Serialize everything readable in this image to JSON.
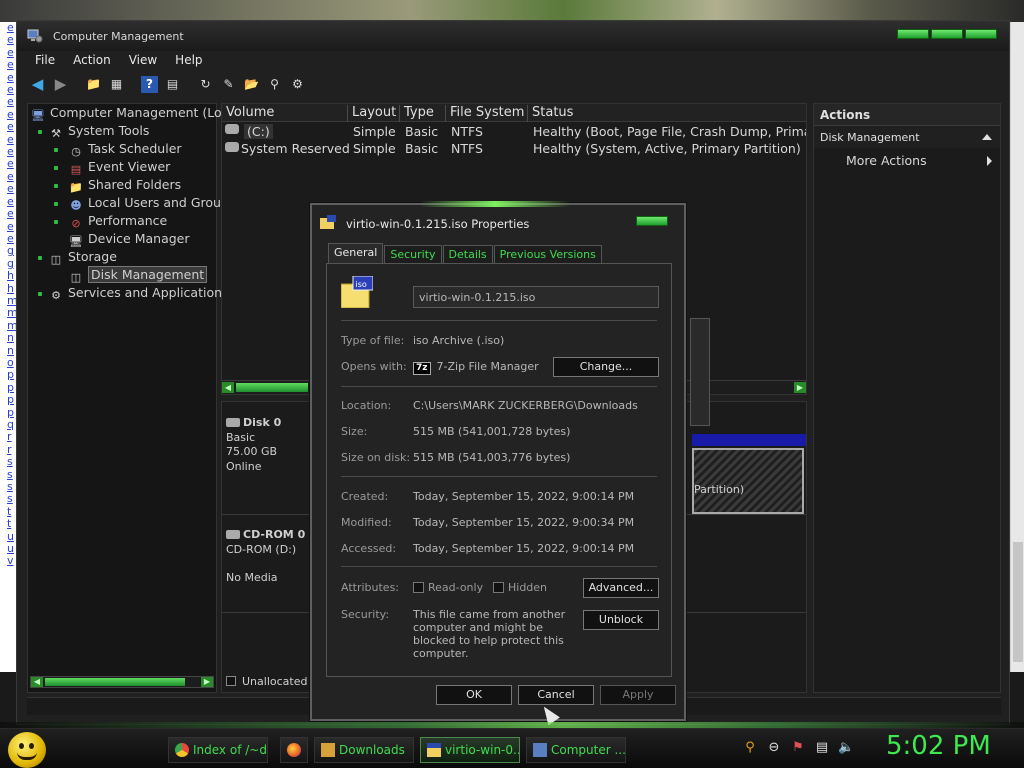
{
  "window": {
    "title": "Computer Management",
    "menu": [
      "File",
      "Action",
      "View",
      "Help"
    ]
  },
  "tree": {
    "root": "Computer Management (Loc",
    "system_tools": "System Tools",
    "task_scheduler": "Task Scheduler",
    "event_viewer": "Event Viewer",
    "shared_folders": "Shared Folders",
    "local_users": "Local Users and Grou",
    "performance": "Performance",
    "device_manager": "Device Manager",
    "storage": "Storage",
    "disk_management": "Disk Management",
    "services": "Services and Application:"
  },
  "volumes": {
    "columns": [
      "Volume",
      "Layout",
      "Type",
      "File System",
      "Status"
    ],
    "rows": [
      {
        "volume": "(C:)",
        "layout": "Simple",
        "type": "Basic",
        "fs": "NTFS",
        "status": "Healthy (Boot, Page File, Crash Dump, Primary"
      },
      {
        "volume": "System Reserved",
        "layout": "Simple",
        "type": "Basic",
        "fs": "NTFS",
        "status": "Healthy (System, Active, Primary Partition)"
      }
    ]
  },
  "disks": {
    "disk0": {
      "name": "Disk 0",
      "type": "Basic",
      "size": "75.00 GB",
      "state": "Online",
      "partition_text": "Partition)"
    },
    "cdrom0": {
      "name": "CD-ROM 0",
      "type": "CD-ROM (D:)",
      "state": "No Media"
    },
    "legend_unallocated": "Unallocated"
  },
  "actions": {
    "header": "Actions",
    "section": "Disk Management",
    "more": "More Actions"
  },
  "dialog": {
    "title": "virtio-win-0.1.215.iso Properties",
    "tabs": [
      "General",
      "Security",
      "Details",
      "Previous Versions"
    ],
    "file_name": "virtio-win-0.1.215.iso",
    "type_label": "Type of file:",
    "type_value": "iso Archive (.iso)",
    "opens_label": "Opens with:",
    "opens_value": "7-Zip File Manager",
    "opens_icon_text": "7z",
    "change_button": "Change...",
    "location_label": "Location:",
    "location_value": "C:\\Users\\MARK ZUCKERBERG\\Downloads",
    "size_label": "Size:",
    "size_value": "515 MB (541,001,728 bytes)",
    "size_on_disk_label": "Size on disk:",
    "size_on_disk_value": "515 MB (541,003,776 bytes)",
    "created_label": "Created:",
    "created_value": "Today, September 15, 2022, 9:00:14 PM",
    "modified_label": "Modified:",
    "modified_value": "Today, September 15, 2022, 9:00:34 PM",
    "accessed_label": "Accessed:",
    "accessed_value": "Today, September 15, 2022, 9:00:14 PM",
    "attributes_label": "Attributes:",
    "readonly_label": "Read-only",
    "hidden_label": "Hidden",
    "advanced_button": "Advanced...",
    "security_label": "Security:",
    "security_text": "This file came from another computer and might be blocked to help protect this computer.",
    "unblock_button": "Unblock",
    "ok_button": "OK",
    "cancel_button": "Cancel",
    "apply_button": "Apply",
    "iso_badge": "iso"
  },
  "taskbar": {
    "items": [
      "Index of /~d...",
      "Downloads",
      "virtio-win-0....",
      "Computer ..."
    ],
    "clock": "5:02 PM"
  },
  "bg_links": [
    "e",
    "e",
    "e",
    "e",
    "e",
    "e",
    "e",
    "e",
    "e",
    "e",
    "e",
    "e",
    "e",
    "e",
    "e",
    "e",
    "e",
    "e",
    "g",
    "g",
    "h",
    "h",
    "m",
    "m",
    "m",
    "n",
    "n",
    "o",
    "p",
    "p",
    "p",
    "p",
    "q",
    "r",
    "r",
    "s",
    "s",
    "s",
    "s",
    "t",
    "t",
    "u",
    "u",
    "v"
  ],
  "colors": {
    "accent": "#3fdc4f",
    "clock": "#3fe84f",
    "link": "#2a3fd0"
  }
}
